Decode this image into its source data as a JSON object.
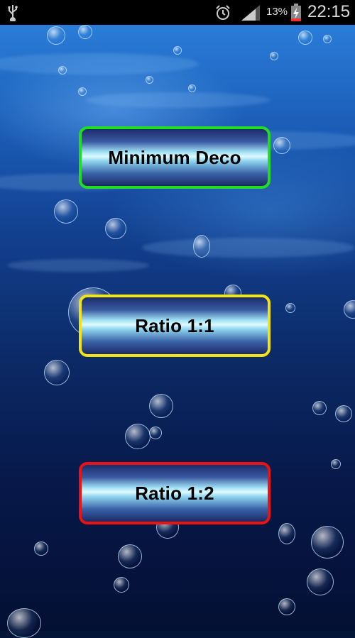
{
  "status_bar": {
    "battery_percent": "13%",
    "time": "22:15"
  },
  "menu": {
    "minimum_deco": {
      "label": "Minimum Deco",
      "border_color": "#22dd22"
    },
    "ratio_1_1": {
      "label": "Ratio 1:1",
      "border_color": "#f2e411"
    },
    "ratio_1_2": {
      "label": "Ratio 1:2",
      "border_color": "#ee1111"
    }
  },
  "icons": [
    "usb-icon",
    "alarm-icon",
    "signal-icon",
    "battery-charging-icon"
  ],
  "background": "underwater-bubbles"
}
